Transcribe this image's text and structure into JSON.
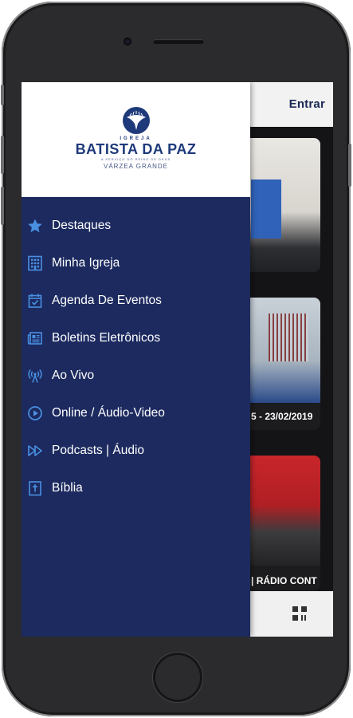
{
  "header": {
    "login_label": "Entrar"
  },
  "logo": {
    "line1": "IGREJA",
    "name": "BATISTA DA PAZ",
    "tagline": "A SERVIÇO DO REINO DE DEUS",
    "city": "VÁRZEA GRANDE"
  },
  "menu": {
    "items": [
      {
        "label": "Destaques",
        "icon": "star-icon"
      },
      {
        "label": "Minha Igreja",
        "icon": "building-icon"
      },
      {
        "label": "Agenda De Eventos",
        "icon": "calendar-check-icon"
      },
      {
        "label": "Boletins Eletrônicos",
        "icon": "newspaper-icon"
      },
      {
        "label": "Ao Vivo",
        "icon": "broadcast-icon"
      },
      {
        "label": "Online / Áudio-Video",
        "icon": "play-circle-icon"
      },
      {
        "label": "Podcasts | Áudio",
        "icon": "fast-forward-icon"
      },
      {
        "label": "Bíblia",
        "icon": "bible-icon"
      }
    ]
  },
  "feed": {
    "cards": [
      {
        "caption": ""
      },
      {
        "caption": "5 - 23/02/2019"
      },
      {
        "caption": "| RÁDIO CONT"
      }
    ]
  },
  "colors": {
    "drawer_bg": "#1c2a5f",
    "icon_accent": "#4a90e2",
    "brand_blue": "#1e3a7a"
  }
}
